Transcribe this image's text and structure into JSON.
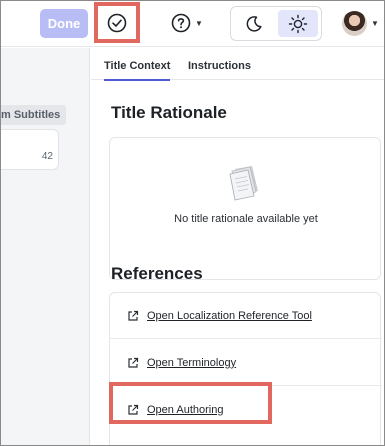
{
  "topbar": {
    "done_label": "Done",
    "icons": {
      "complete": "check-circle-icon",
      "help": "question-circle-icon",
      "dark_mode": "moon-icon",
      "light_mode": "sun-icon",
      "caret": "caret-down-icon"
    },
    "theme_active": "light"
  },
  "left_panel": {
    "tag_label": "m Subtitles",
    "card_count": "42"
  },
  "tabs": [
    {
      "label": "Title Context",
      "active": true
    },
    {
      "label": "Instructions",
      "active": false
    }
  ],
  "title_rationale": {
    "heading": "Title Rationale",
    "empty_message": "No title rationale available yet",
    "empty_icon": "documents-icon"
  },
  "references": {
    "heading": "References",
    "items": [
      {
        "label": "Open Localization Reference Tool",
        "icon": "external-link-icon"
      },
      {
        "label": "Open Terminology",
        "icon": "external-link-icon"
      },
      {
        "label": "Open Authoring",
        "icon": "external-link-icon"
      }
    ]
  },
  "colors": {
    "accent": "#4f5bd5",
    "done_disabled": "#b9bdf6",
    "highlight": "#e0685e",
    "theme_active_bg": "#e3e6fb"
  }
}
